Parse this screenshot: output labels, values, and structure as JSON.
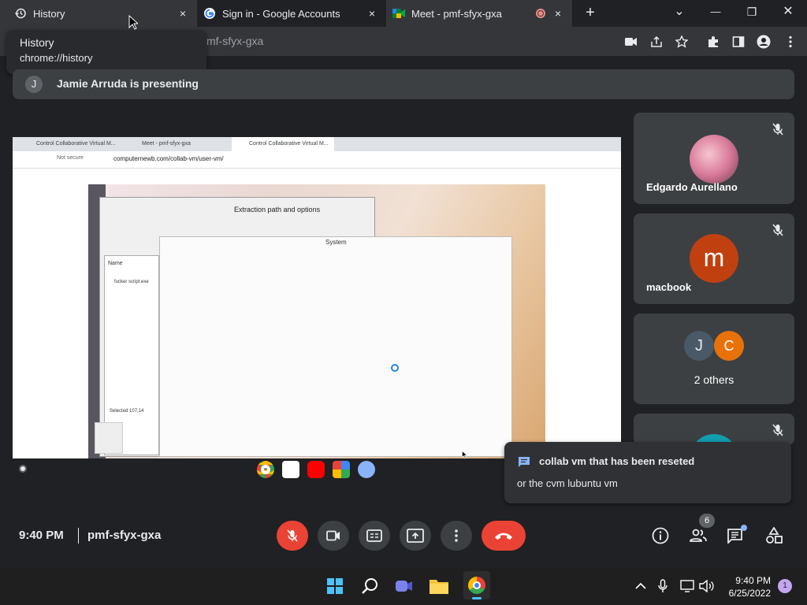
{
  "tabs": [
    {
      "title": "History",
      "close": "×"
    },
    {
      "title": "Sign in - Google Accounts",
      "close": "×"
    },
    {
      "title": "Meet - pmf-sfyx-gxa",
      "close": "×"
    }
  ],
  "new_tab": "+",
  "window_controls": {
    "dropdown": "⌄",
    "minimize": "—",
    "restore": "❐",
    "close": "✕"
  },
  "tooltip": {
    "title": "History",
    "url": "chrome://history"
  },
  "address": {
    "url": "mf-sfyx-gxa"
  },
  "presenting": {
    "avatar": "J",
    "text": "Jamie Arruda is presenting"
  },
  "shared_screen": {
    "tabs": [
      "Control Collaborative Virtual M...",
      "Meet - pmf-sfyx-gxa",
      "Control Collaborative Virtual M..."
    ],
    "not_secure": "Not secure",
    "url": "computernewb.com/collab-vm/user-vm/",
    "dialog_title": "Extraction path and options",
    "system_title": "System",
    "explorer_header": "Name",
    "explorer_file": "fucker script.exe",
    "explorer_status": "Selected 107,14"
  },
  "participants": [
    {
      "name": "Edgardo Aurellano",
      "muted": true
    },
    {
      "name": "macbook",
      "initial": "m",
      "avatar_color": "#c1400f",
      "muted": true
    },
    {
      "name": "2 others",
      "initials": [
        "J",
        "C"
      ],
      "avatar_colors": [
        "#4a5967",
        "#e8710a"
      ]
    }
  ],
  "chat": {
    "line1": "collab vm that has been reseted",
    "line2": "or the cvm lubuntu vm"
  },
  "meeting": {
    "time": "9:40 PM",
    "code": "pmf-sfyx-gxa",
    "people_count": "6"
  },
  "colors": {
    "end_call": "#ea4335",
    "mic_off": "#ea4335",
    "chrome_bg": "#202124",
    "tile_bg": "#3c4043"
  },
  "taskbar": {
    "time": "9:40 PM",
    "date": "6/25/2022",
    "notifications": "1"
  }
}
